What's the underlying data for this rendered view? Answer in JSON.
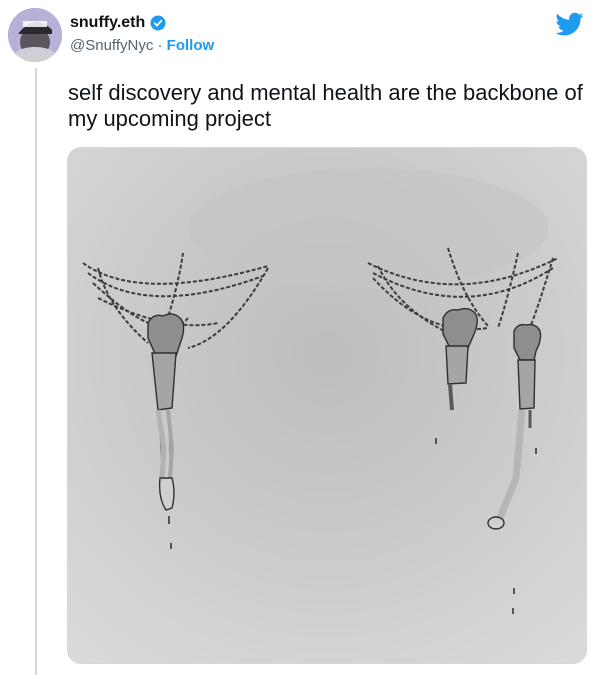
{
  "tweet": {
    "author": {
      "display_name": "snuffy.eth",
      "handle": "@SnuffyNyc",
      "separator": "·",
      "follow_label": "Follow",
      "verified": true,
      "avatar_icon": "person-with-cap-avatar"
    },
    "text": "self discovery and mental health are the backbone of my upcoming project",
    "media": {
      "type": "illustration",
      "subject": "chained-forearms-and-bones-illustration"
    },
    "brand_icon": "twitter-bird-icon"
  },
  "colors": {
    "accent": "#1d9bf0",
    "text_primary": "#0f1419",
    "text_secondary": "#536471",
    "border": "#cfd9de"
  }
}
